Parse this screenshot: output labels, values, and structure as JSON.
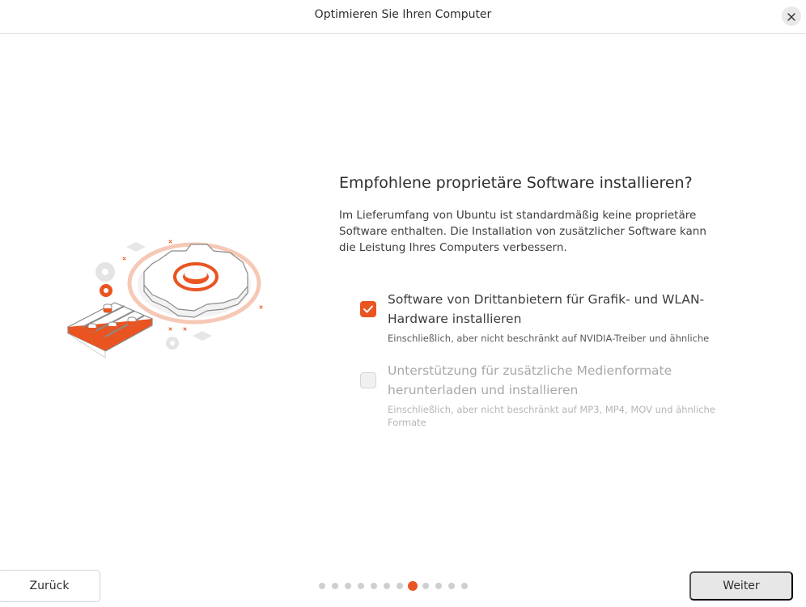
{
  "window": {
    "title": "Optimieren Sie Ihren Computer"
  },
  "icons": {
    "close": "close-icon",
    "checkmark": "checkmark-icon",
    "illustration": "gear-settings-illustration"
  },
  "colors": {
    "accent": "#e95420",
    "dot_inactive": "#cfcfcf",
    "next_button_bg": "#e7e7e7"
  },
  "main": {
    "heading": "Empfohlene proprietäre Software installieren?",
    "description": "Im Lieferumfang von Ubuntu ist standardmäßig keine proprietäre Software enthalten. Die Installation von zusätzlicher Software kann die Leistung Ihres Computers verbessern.",
    "options": [
      {
        "label": "Software von Drittanbietern für Grafik- und WLAN-Hardware installieren",
        "sublabel": "Einschließlich, aber nicht beschränkt auf NVIDIA-Treiber und ähnliche",
        "checked": true,
        "enabled": true
      },
      {
        "label": "Unterstützung für zusätzliche Medienformate herunterladen und installieren",
        "sublabel": "Einschließlich, aber nicht beschränkt auf MP3, MP4, MOV und ähnliche Formate",
        "checked": false,
        "enabled": false
      }
    ]
  },
  "footer": {
    "back_label": "Zurück",
    "next_label": "Weiter",
    "steps_total": 12,
    "current_step": 8
  }
}
